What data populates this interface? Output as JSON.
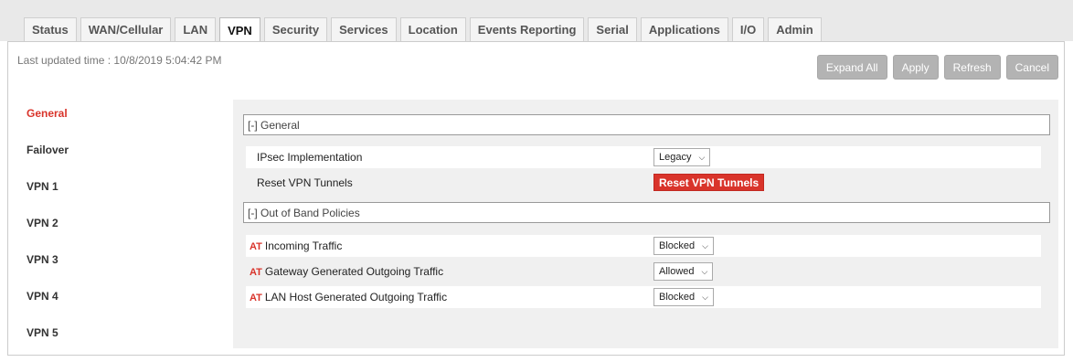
{
  "tabs": [
    {
      "label": "Status"
    },
    {
      "label": "WAN/Cellular"
    },
    {
      "label": "LAN"
    },
    {
      "label": "VPN"
    },
    {
      "label": "Security"
    },
    {
      "label": "Services"
    },
    {
      "label": "Location"
    },
    {
      "label": "Events Reporting"
    },
    {
      "label": "Serial"
    },
    {
      "label": "Applications"
    },
    {
      "label": "I/O"
    },
    {
      "label": "Admin"
    }
  ],
  "active_tab": "VPN",
  "last_updated": "Last updated time : 10/8/2019 5:04:42 PM",
  "toolbar": {
    "expand_all": "Expand All",
    "apply": "Apply",
    "refresh": "Refresh",
    "cancel": "Cancel"
  },
  "sidenav": {
    "items": [
      {
        "label": "General"
      },
      {
        "label": "Failover"
      },
      {
        "label": "VPN 1"
      },
      {
        "label": "VPN 2"
      },
      {
        "label": "VPN 3"
      },
      {
        "label": "VPN 4"
      },
      {
        "label": "VPN 5"
      }
    ],
    "active": "General"
  },
  "general_section": {
    "title": "[-] General",
    "ipsec_label": "IPsec Implementation",
    "ipsec_value": "Legacy",
    "reset_label": "Reset VPN Tunnels",
    "reset_button": "Reset VPN Tunnels"
  },
  "oob_section": {
    "title": "[-] Out of Band Policies",
    "at_tag": "AT",
    "rows": [
      {
        "label": "Incoming Traffic",
        "value": "Blocked"
      },
      {
        "label": "Gateway Generated Outgoing Traffic",
        "value": "Allowed"
      },
      {
        "label": "LAN Host Generated Outgoing Traffic",
        "value": "Blocked"
      }
    ]
  },
  "colors": {
    "accent_red": "#d9342b",
    "button_gray": "#b3b3b3",
    "content_bg": "#f0f0f0"
  }
}
